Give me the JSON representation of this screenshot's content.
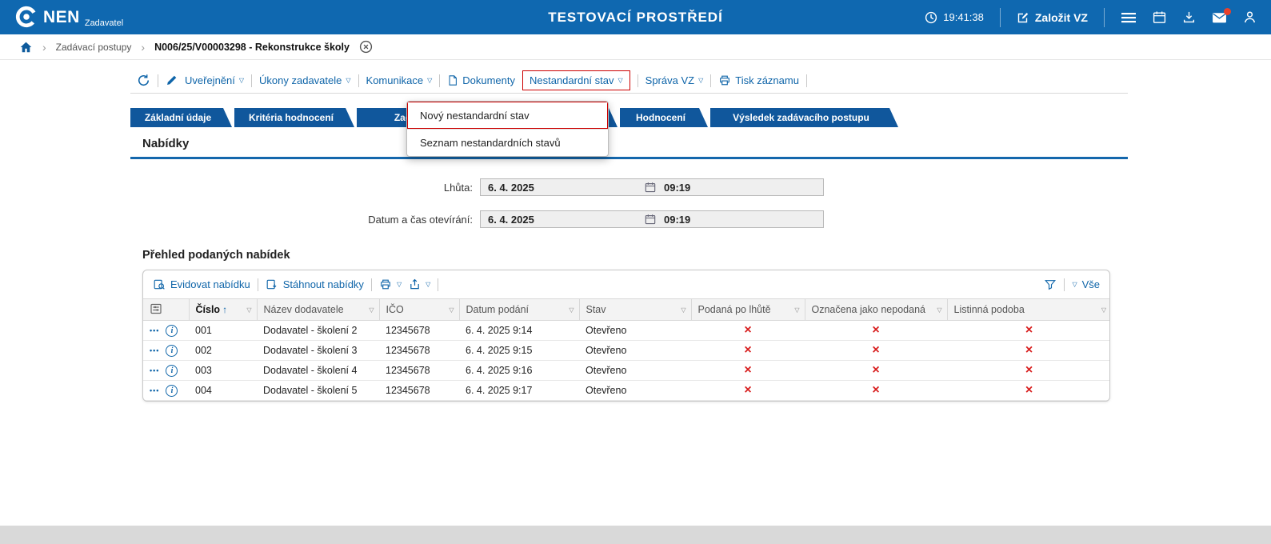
{
  "icons": {
    "caret": "▽",
    "sort_asc": "↑",
    "dots": "•••",
    "info": "i",
    "sep": "›"
  },
  "topbar": {
    "logo": "NEN",
    "logo_sub": "Zadavatel",
    "env_title": "TESTOVACÍ PROSTŘEDÍ",
    "time": "19:41:38",
    "create_button": "Založit VZ"
  },
  "breadcrumb": {
    "level1": "Zadávací postupy",
    "level2": "N006/25/V00003298 - Rekonstrukce školy"
  },
  "toolbar": {
    "items": [
      {
        "label": "Uveřejnění"
      },
      {
        "label": "Úkony zadavatele"
      },
      {
        "label": "Komunikace"
      },
      {
        "label": "Dokumenty"
      },
      {
        "label": "Nestandardní stav"
      },
      {
        "label": "Správa VZ"
      },
      {
        "label": "Tisk záznamu"
      }
    ]
  },
  "menu": {
    "items": [
      {
        "label": "Nový nestandardní stav"
      },
      {
        "label": "Seznam nestandardních stavů"
      }
    ]
  },
  "tabs": [
    "Základní údaje",
    "Kritéria hodnocení",
    "Zadáva",
    "",
    "Hodnocení",
    "Výsledek zadávacího postupu"
  ],
  "section": {
    "title": "Nabídky",
    "fields": [
      {
        "label": "Lhůta:",
        "date": "6. 4. 2025",
        "time": "09:19"
      },
      {
        "label": "Datum a čas otevírání:",
        "date": "6. 4. 2025",
        "time": "09:19"
      }
    ]
  },
  "bids": {
    "title": "Přehled podaných nabídek",
    "toolbar": {
      "register": "Evidovat nabídku",
      "download": "Stáhnout nabídky",
      "all": "Vše"
    },
    "columns": [
      "Číslo",
      "Název dodavatele",
      "IČO",
      "Datum podání",
      "Stav",
      "Podaná po lhůtě",
      "Označena jako nepodaná",
      "Listinná podoba"
    ],
    "rows": [
      [
        "001",
        "Dodavatel - školení 2",
        "12345678",
        "6. 4. 2025 9:14",
        "Otevřeno",
        "×",
        "×",
        "×"
      ],
      [
        "002",
        "Dodavatel - školení 3",
        "12345678",
        "6. 4. 2025 9:15",
        "Otevřeno",
        "×",
        "×",
        "×"
      ],
      [
        "003",
        "Dodavatel - školení 4",
        "12345678",
        "6. 4. 2025 9:16",
        "Otevřeno",
        "×",
        "×",
        "×"
      ],
      [
        "004",
        "Dodavatel - školení 5",
        "12345678",
        "6. 4. 2025 9:17",
        "Otevřeno",
        "×",
        "×",
        "×"
      ]
    ]
  },
  "colors": {
    "header_blue": "#0f68b0",
    "tab_blue": "#10579c",
    "link_blue": "#0f65a9",
    "highlight_red": "#cc0000",
    "cross_red": "#d81e1e"
  }
}
